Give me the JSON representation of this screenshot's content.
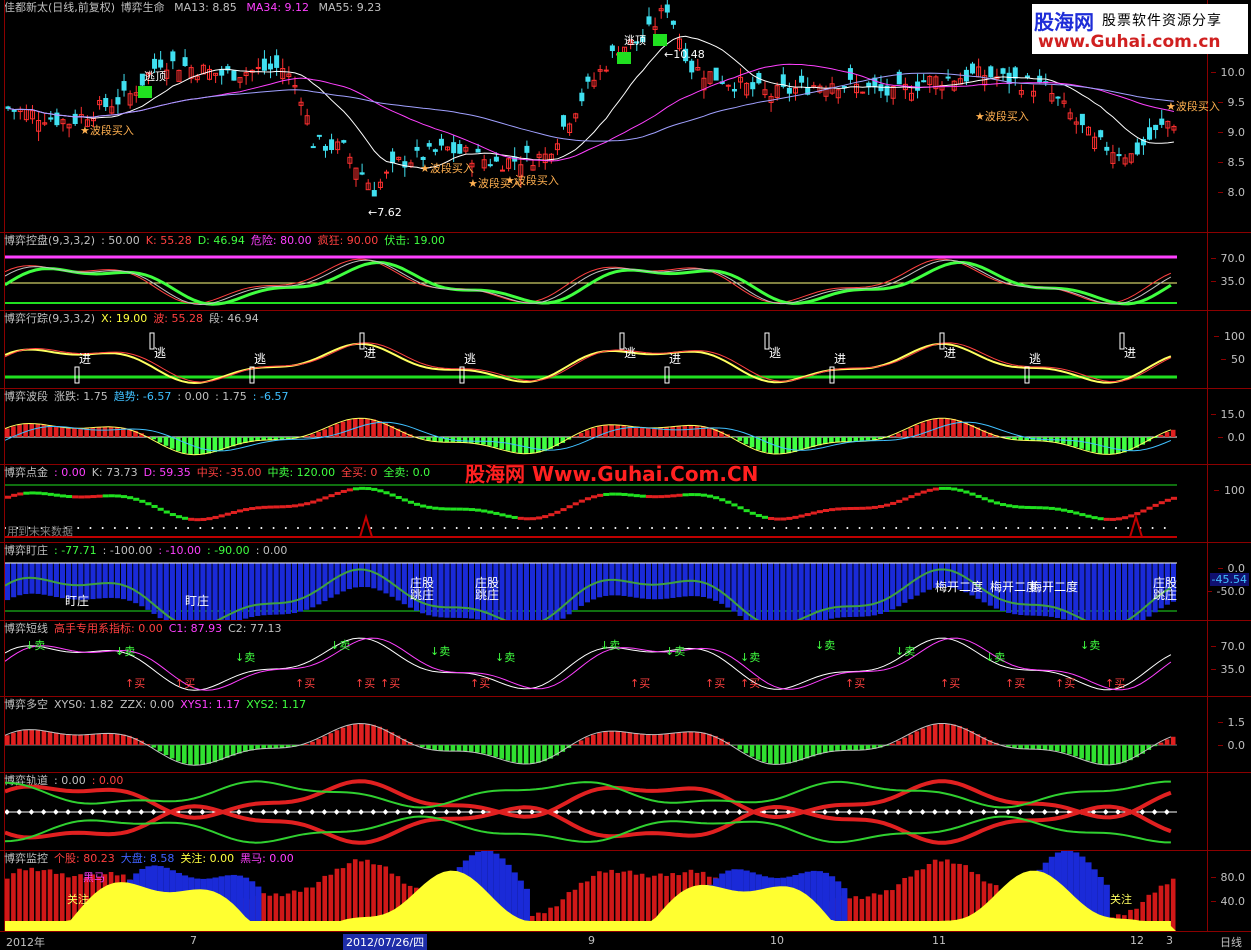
{
  "main": {
    "title": "佳都新太(日线,前复权)",
    "indicator": "博弈生命",
    "ma13": {
      "label": "MA13:",
      "value": "8.85"
    },
    "ma34": {
      "label": "MA34:",
      "value": "9.12"
    },
    "ma55": {
      "label": "MA55:",
      "value": "9.23"
    },
    "y_ticks": [
      "10.0",
      "9.5",
      "9.0",
      "8.5",
      "8.0"
    ],
    "annotations": {
      "top_signal": "逃顶",
      "left_signal": "逃顶",
      "high": "10.48",
      "low": "7.62",
      "buy_signals": [
        "波段买入",
        "波段买入",
        "波段买入",
        "波段买入",
        "波段买入",
        "波段买入"
      ]
    }
  },
  "watermark": {
    "brand": "股海网",
    "tagline": "股票软件资源分享",
    "url": "www.Guhai.com.cn",
    "mid_text": "股海网 Www.Guhai.Com.CN"
  },
  "panes": [
    {
      "id": "kongpan",
      "title": "博弈控盘(9,3,3,2)",
      "fields": [
        {
          "label": "",
          "value": ": 50.00",
          "color": "#c0c0c0"
        },
        {
          "label": "K:",
          "value": "55.28",
          "color": "#ff4040"
        },
        {
          "label": "D:",
          "value": "46.94",
          "color": "#40ff40"
        },
        {
          "label": "危险:",
          "value": "80.00",
          "color": "#ff40ff"
        },
        {
          "label": "疯狂:",
          "value": "90.00",
          "color": "#ff4040"
        },
        {
          "label": "伏击:",
          "value": "19.00",
          "color": "#40ff40"
        }
      ],
      "ticks": [
        "70.0",
        "35.0"
      ]
    },
    {
      "id": "xingzong",
      "title": "博弈行踪(9,3,3,2)",
      "fields": [
        {
          "label": "X:",
          "value": "19.00",
          "color": "#ffff40"
        },
        {
          "label": "波:",
          "value": "55.28",
          "color": "#ff4040"
        },
        {
          "label": "段:",
          "value": "46.94",
          "color": "#c0c0c0"
        }
      ],
      "ticks": [
        "100",
        "50"
      ],
      "signals": [
        "进",
        "逃",
        "逃",
        "进",
        "逃",
        "逃",
        "进",
        "逃",
        "进",
        "进",
        "逃",
        "进"
      ]
    },
    {
      "id": "boduan",
      "title": "博弈波段",
      "fields": [
        {
          "label": "涨跌:",
          "value": "1.75",
          "color": "#c0c0c0"
        },
        {
          "label": "趋势:",
          "value": "-6.57",
          "color": "#40c0ff"
        },
        {
          "label": "",
          "value": ": 0.00",
          "color": "#c0c0c0"
        },
        {
          "label": "",
          "value": ": 1.75",
          "color": "#c0c0c0"
        },
        {
          "label": "",
          "value": ": -6.57",
          "color": "#40c0ff"
        }
      ],
      "ticks": [
        "15.0",
        "0.0"
      ]
    },
    {
      "id": "dianjin",
      "title": "博弈点金",
      "fields": [
        {
          "label": "",
          "value": ": 0.00",
          "color": "#ff40ff"
        },
        {
          "label": "K:",
          "value": "73.73",
          "color": "#c0c0c0"
        },
        {
          "label": "D:",
          "value": "59.35",
          "color": "#ff40ff"
        },
        {
          "label": "中买:",
          "value": "-35.00",
          "color": "#ff4040"
        },
        {
          "label": "中卖:",
          "value": "120.00",
          "color": "#40ff40"
        },
        {
          "label": "全买:",
          "value": "0",
          "color": "#ff4040"
        },
        {
          "label": "全卖:",
          "value": "0.0",
          "color": "#40ff40"
        }
      ],
      "ticks": [
        "100"
      ],
      "footer": "用到未来数据"
    },
    {
      "id": "dingzhuang",
      "title": "博弈盯庄",
      "fields": [
        {
          "label": "",
          "value": ": -77.71",
          "color": "#40ff40"
        },
        {
          "label": "",
          "value": ": -100.00",
          "color": "#c0c0c0"
        },
        {
          "label": "",
          "value": ": -10.00",
          "color": "#ff40ff"
        },
        {
          "label": "",
          "value": ": -90.00",
          "color": "#40ff40"
        },
        {
          "label": "",
          "value": ": 0.00",
          "color": "#c0c0c0"
        }
      ],
      "ticks": [
        "0.0",
        "-50.0"
      ],
      "current": "-45.54",
      "labels": [
        "盯庄",
        "盯庄",
        "庄股\n跳庄",
        "庄股\n跳庄",
        "梅开二度",
        "梅开二度",
        "梅开二度",
        "庄股\n跳庄"
      ]
    },
    {
      "id": "duanxian",
      "title": "博弈短线",
      "fields": [
        {
          "label": "高手专用系指标:",
          "value": "0.00",
          "color": "#ff4040"
        },
        {
          "label": "C1:",
          "value": "87.93",
          "color": "#ff40ff"
        },
        {
          "label": "C2:",
          "value": "77.13",
          "color": "#c0c0c0"
        }
      ],
      "ticks": [
        "70.0",
        "35.0"
      ],
      "buy": "买",
      "sell": "卖"
    },
    {
      "id": "duokong",
      "title": "博弈多空",
      "fields": [
        {
          "label": "XYS0:",
          "value": "1.82",
          "color": "#c0c0c0"
        },
        {
          "label": "ZZX:",
          "value": "0.00",
          "color": "#c0c0c0"
        },
        {
          "label": "XYS1:",
          "value": "1.17",
          "color": "#ff40ff"
        },
        {
          "label": "XYS2:",
          "value": "1.17",
          "color": "#40ff40"
        }
      ],
      "ticks": [
        "1.5",
        "0.0"
      ]
    },
    {
      "id": "guidao",
      "title": "博弈轨道",
      "fields": [
        {
          "label": "",
          "value": ": 0.00",
          "color": "#c0c0c0"
        },
        {
          "label": "",
          "value": ": 0.00",
          "color": "#ff4040"
        }
      ],
      "ticks": []
    },
    {
      "id": "jiankong",
      "title": "博弈监控",
      "fields": [
        {
          "label": "个股:",
          "value": "80.23",
          "color": "#ff4040"
        },
        {
          "label": "大盘:",
          "value": "8.58",
          "color": "#4060ff"
        },
        {
          "label": "关注:",
          "value": "0.00",
          "color": "#ffff40"
        },
        {
          "label": "黑马:",
          "value": "0.00",
          "color": "#ff40ff"
        }
      ],
      "ticks": [
        "80.0",
        "40.0"
      ],
      "tags": [
        "黑马",
        "关注",
        "关注"
      ]
    }
  ],
  "xaxis": {
    "labels": [
      "2012年",
      "7",
      "2012/07/26/四",
      "9",
      "10",
      "11",
      "12",
      "3"
    ],
    "right": "日线"
  }
}
